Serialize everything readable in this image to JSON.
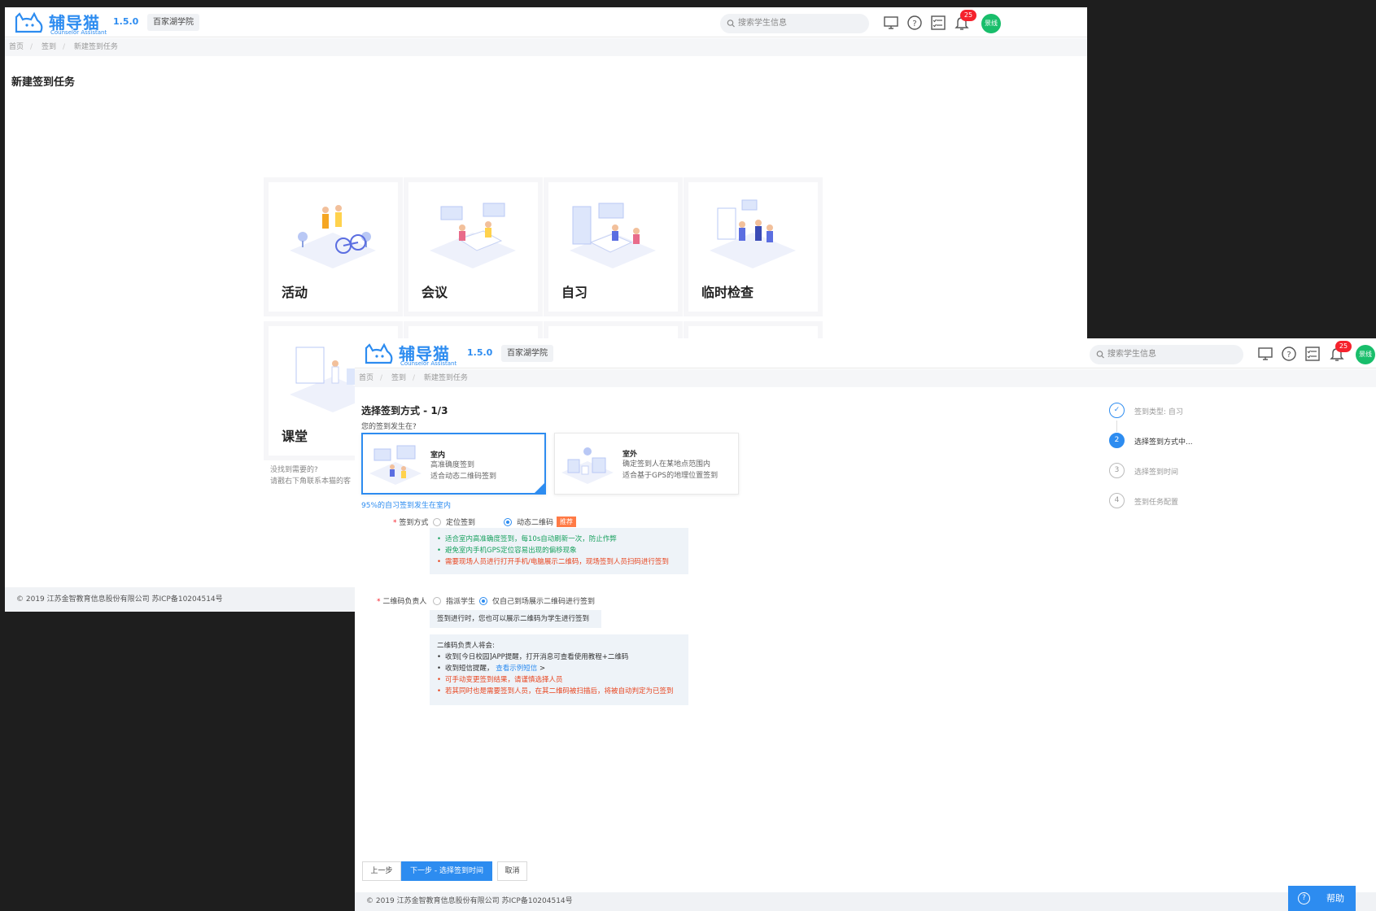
{
  "app": {
    "brand": "辅导猫",
    "brand_sub": "Counselor Assistant",
    "version": "1.5.0",
    "school": "百家湖学院",
    "search_placeholder": "搜索学生信息",
    "notification_count": "25",
    "user": "景线",
    "accent_color": "#2d8cf0"
  },
  "window1": {
    "breadcrumb": [
      "首页",
      "签到",
      "新建签到任务"
    ],
    "title": "新建签到任务",
    "cards": [
      {
        "label": "活动",
        "icon": "activity-illustration"
      },
      {
        "label": "会议",
        "icon": "meeting-illustration"
      },
      {
        "label": "自习",
        "icon": "self-study-illustration"
      },
      {
        "label": "临时检查",
        "icon": "spot-check-illustration"
      },
      {
        "label": "课堂",
        "icon": "classroom-illustration"
      }
    ],
    "hint_line1": "没找到需要的?",
    "hint_line2": "请戳右下角联系本猫的客",
    "footer": "© 2019 江苏金智教育信息股份有限公司 苏ICP备10204514号"
  },
  "window2": {
    "breadcrumb": [
      "首页",
      "签到",
      "新建签到任务"
    ],
    "title": "选择签到方式 - 1/3",
    "question": "您的签到发生在?",
    "options": [
      {
        "title": "室内",
        "desc1": "高准确度签到",
        "desc2": "适合动态二维码签到",
        "selected": true
      },
      {
        "title": "室外",
        "desc1": "确定签到人在某地点范围内",
        "desc2": "适合基于GPS的地理位置签到",
        "selected": false
      }
    ],
    "note": "95%的自习签到发生在室内",
    "method": {
      "label": "签到方式",
      "choices": [
        "定位签到",
        "动态二维码"
      ],
      "selected": "动态二维码",
      "tag": "推荐",
      "tips": [
        "适合室内高准确度签到，每10s自动刷新一次，防止作弊",
        "避免室内手机GPS定位容易出现的偏移现象",
        "需要现场人员进行打开手机/电脑展示二维码，现场签到人员扫码进行签到"
      ]
    },
    "owner": {
      "label": "二维码负责人",
      "choices": [
        "指派学生",
        "仅自己到场展示二维码进行签到"
      ],
      "selected": "仅自己到场展示二维码进行签到",
      "info": "签到进行时，您也可以展示二维码为学生进行签到",
      "will_title": "二维码负责人将会:",
      "will_items": [
        "收到[今日校园]APP提醒，打开消息可查看使用教程+二维码",
        "收到短信提醒，",
        "可手动变更签到结果，请谨慎选择人员",
        "若其同时也是需要签到人员，在其二维码被扫描后，将被自动判定为已签到"
      ],
      "sms_link": "查看示例短信",
      "sms_arrow": ">"
    },
    "steps": [
      {
        "num": "✓",
        "label": "签到类型: 自习",
        "state": "done"
      },
      {
        "num": "2",
        "label": "选择签到方式中...",
        "state": "current"
      },
      {
        "num": "3",
        "label": "选择签到时间",
        "state": "todo"
      },
      {
        "num": "4",
        "label": "签到任务配置",
        "state": "todo"
      }
    ],
    "buttons": {
      "prev": "上一步",
      "next": "下一步 - 选择签到时间",
      "cancel": "取消"
    },
    "footer": "© 2019 江苏金智教育信息股份有限公司 苏ICP备10204514号",
    "help": "帮助",
    "help_icon": "?"
  }
}
